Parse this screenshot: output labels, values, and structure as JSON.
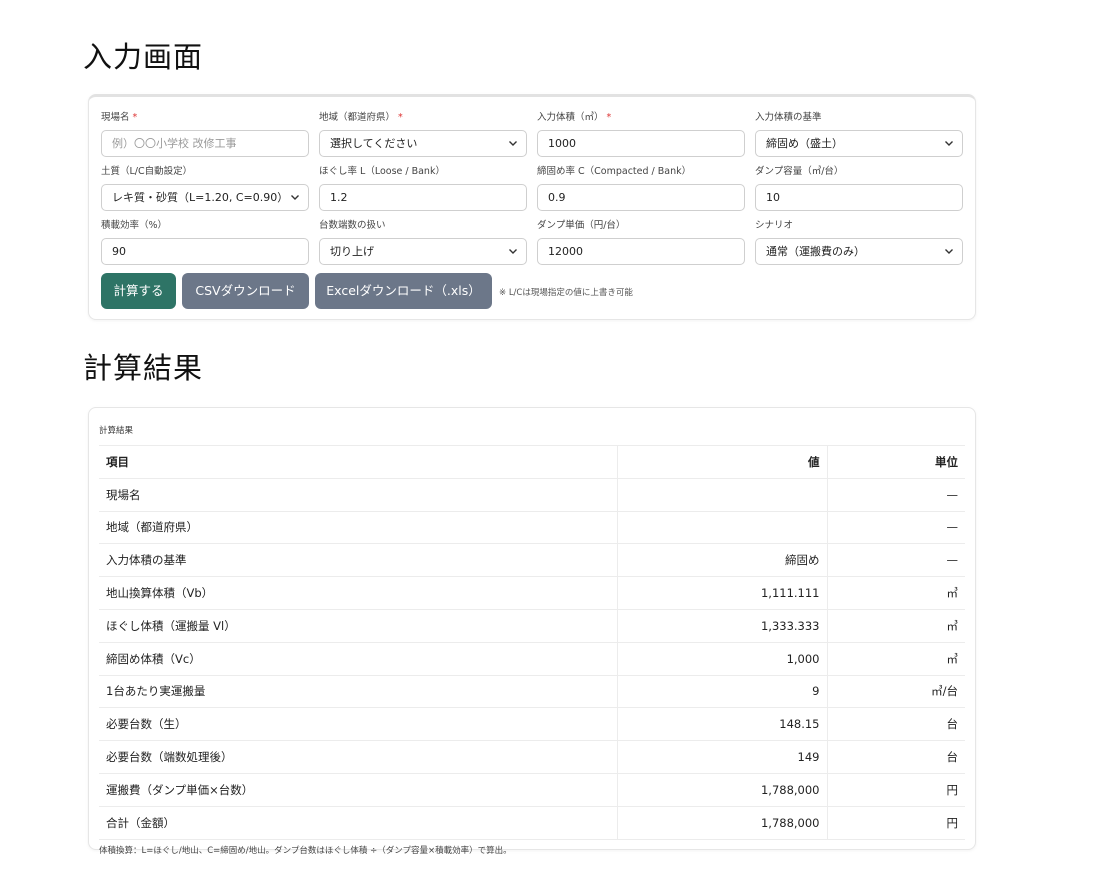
{
  "titles": {
    "input": "入力画面",
    "result": "計算結果"
  },
  "form": {
    "fields": [
      {
        "label": "現場名",
        "required": true,
        "type": "input",
        "value": "",
        "placeholder": "例）〇〇小学校 改修工事"
      },
      {
        "label": "地域（都道府県）",
        "required": true,
        "type": "select",
        "value": "選択してください"
      },
      {
        "label": "入力体積（㎥）",
        "required": true,
        "type": "input",
        "value": "1000",
        "placeholder": ""
      },
      {
        "label": "入力体積の基準",
        "required": false,
        "type": "select",
        "value": "締固め（盛土）"
      },
      {
        "label": "土質（L/C自動設定）",
        "required": false,
        "type": "select",
        "value": "レキ質・砂質（L=1.20, C=0.90）"
      },
      {
        "label": "ほぐし率 L（Loose / Bank）",
        "required": false,
        "type": "input",
        "value": "1.2",
        "placeholder": ""
      },
      {
        "label": "締固め率 C（Compacted / Bank）",
        "required": false,
        "type": "input",
        "value": "0.9",
        "placeholder": ""
      },
      {
        "label": "ダンプ容量（㎥/台）",
        "required": false,
        "type": "input",
        "value": "10",
        "placeholder": ""
      },
      {
        "label": "積載効率（%）",
        "required": false,
        "type": "input",
        "value": "90",
        "placeholder": ""
      },
      {
        "label": "台数端数の扱い",
        "required": false,
        "type": "select",
        "value": "切り上げ"
      },
      {
        "label": "ダンプ単価（円/台）",
        "required": false,
        "type": "input",
        "value": "12000",
        "placeholder": ""
      },
      {
        "label": "シナリオ",
        "required": false,
        "type": "select",
        "value": "通常（運搬費のみ）"
      }
    ],
    "required_mark": "*",
    "buttons": {
      "calc": "計算する",
      "csv": "CSVダウンロード",
      "excel": "Excelダウンロード（.xls）"
    },
    "note": "※ L/Cは現場指定の値に上書き可能"
  },
  "result": {
    "caption": "計算結果",
    "headers": {
      "item": "項目",
      "value": "値",
      "unit": "単位"
    },
    "rows": [
      {
        "item": "現場名",
        "value": "",
        "unit": "—"
      },
      {
        "item": "地域（都道府県）",
        "value": "",
        "unit": "—"
      },
      {
        "item": "入力体積の基準",
        "value": "締固め",
        "unit": "—"
      },
      {
        "item": "地山換算体積（Vb）",
        "value": "1,111.111",
        "unit": "㎥"
      },
      {
        "item": "ほぐし体積（運搬量 Vl）",
        "value": "1,333.333",
        "unit": "㎥"
      },
      {
        "item": "締固め体積（Vc）",
        "value": "1,000",
        "unit": "㎥"
      },
      {
        "item": "1台あたり実運搬量",
        "value": "9",
        "unit": "㎥/台"
      },
      {
        "item": "必要台数（生）",
        "value": "148.15",
        "unit": "台"
      },
      {
        "item": "必要台数（端数処理後）",
        "value": "149",
        "unit": "台"
      },
      {
        "item": "運搬費（ダンプ単価×台数）",
        "value": "1,788,000",
        "unit": "円"
      },
      {
        "item": "合計（金額）",
        "value": "1,788,000",
        "unit": "円"
      }
    ],
    "footnote": "体積換算：L=ほぐし/地山、C=締固め/地山。ダンプ台数はほぐし体積 ÷（ダンプ容量×積載効率）で算出。"
  },
  "colors": {
    "primary_button": "#2e7466",
    "secondary_button": "#6c7789",
    "required_mark": "#dd3333"
  }
}
